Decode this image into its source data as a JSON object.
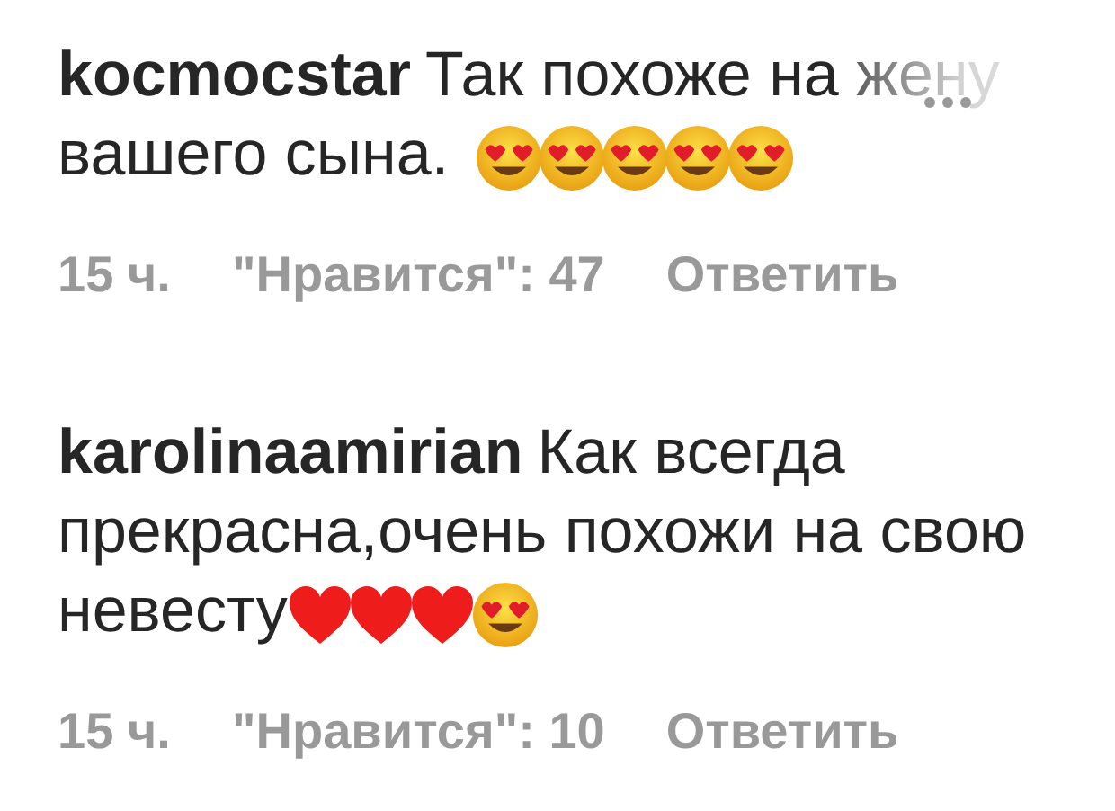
{
  "comments": [
    {
      "username": "kocmocstar",
      "text": "Так похоже на жену вашего сына.",
      "emojis": [
        {
          "kind": "heart_eyes"
        },
        {
          "kind": "heart_eyes"
        },
        {
          "kind": "heart_eyes"
        },
        {
          "kind": "heart_eyes"
        },
        {
          "kind": "heart_eyes"
        }
      ],
      "more_faded": true,
      "time": "15 ч.",
      "likes": "\"Нравится\": 47",
      "reply": "Ответить"
    },
    {
      "username": "karolinaamirian",
      "text": "Как всегда прекрасна,очень похожи на свою невесту",
      "emojis": [
        {
          "kind": "heart"
        },
        {
          "kind": "heart"
        },
        {
          "kind": "heart"
        },
        {
          "kind": "heart_eyes"
        }
      ],
      "more_faded": false,
      "time": "15 ч.",
      "likes": "\"Нравится\": 10",
      "reply": "Ответить"
    }
  ]
}
